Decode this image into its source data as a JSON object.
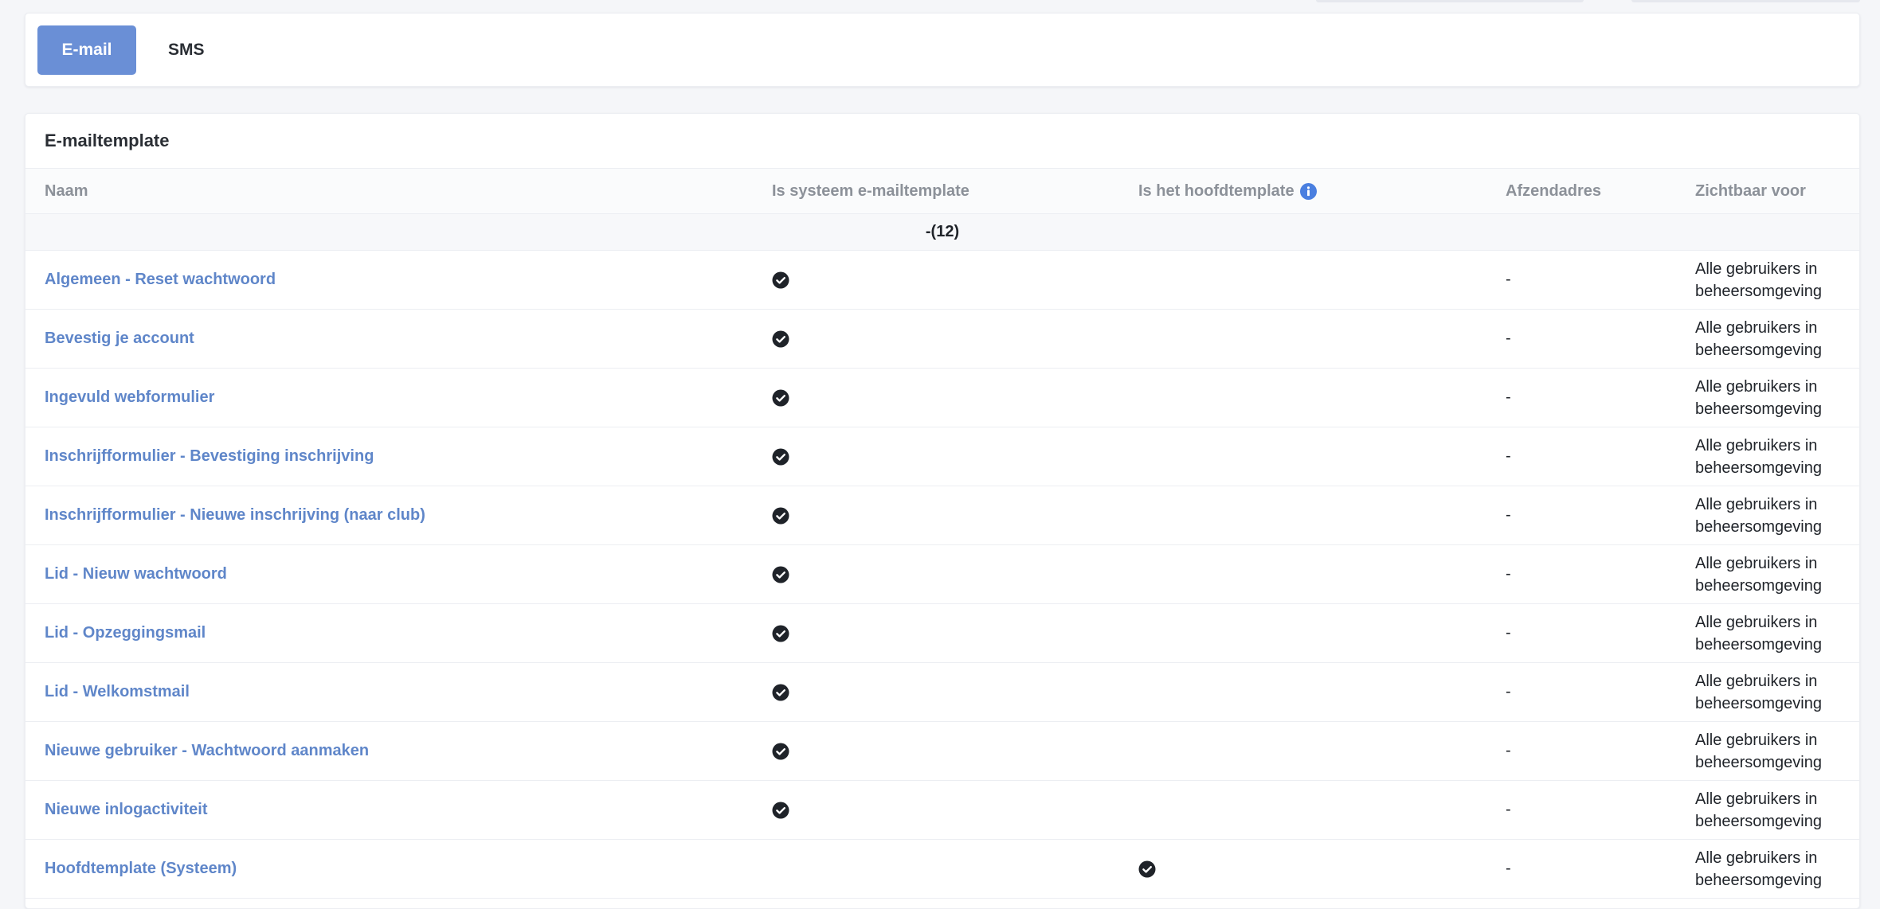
{
  "tabs": [
    {
      "label": "E-mail",
      "active": true
    },
    {
      "label": "SMS",
      "active": false
    }
  ],
  "card": {
    "title": "E-mailtemplate"
  },
  "columns": {
    "name": "Naam",
    "is_system": "Is systeem e-mailtemplate",
    "is_main": "Is het hoofdtemplate",
    "sender": "Afzendadres",
    "visible_for": "Zichtbaar voor"
  },
  "group": {
    "label": "-(12)"
  },
  "rows": [
    {
      "name": "Algemeen - Reset wachtwoord",
      "is_system": true,
      "is_main": false,
      "sender": "-",
      "visible_for": "Alle gebruikers in beheersomgeving"
    },
    {
      "name": "Bevestig je account",
      "is_system": true,
      "is_main": false,
      "sender": "-",
      "visible_for": "Alle gebruikers in beheersomgeving"
    },
    {
      "name": "Ingevuld webformulier",
      "is_system": true,
      "is_main": false,
      "sender": "-",
      "visible_for": "Alle gebruikers in beheersomgeving"
    },
    {
      "name": "Inschrijfformulier - Bevestiging inschrijving",
      "is_system": true,
      "is_main": false,
      "sender": "-",
      "visible_for": "Alle gebruikers in beheersomgeving"
    },
    {
      "name": "Inschrijfformulier - Nieuwe inschrijving (naar club)",
      "is_system": true,
      "is_main": false,
      "sender": "-",
      "visible_for": "Alle gebruikers in beheersomgeving"
    },
    {
      "name": "Lid - Nieuw wachtwoord",
      "is_system": true,
      "is_main": false,
      "sender": "-",
      "visible_for": "Alle gebruikers in beheersomgeving"
    },
    {
      "name": "Lid - Opzeggingsmail",
      "is_system": true,
      "is_main": false,
      "sender": "-",
      "visible_for": "Alle gebruikers in beheersomgeving"
    },
    {
      "name": "Lid - Welkomstmail",
      "is_system": true,
      "is_main": false,
      "sender": "-",
      "visible_for": "Alle gebruikers in beheersomgeving"
    },
    {
      "name": "Nieuwe gebruiker - Wachtwoord aanmaken",
      "is_system": true,
      "is_main": false,
      "sender": "-",
      "visible_for": "Alle gebruikers in beheersomgeving"
    },
    {
      "name": "Nieuwe inlogactiviteit",
      "is_system": true,
      "is_main": false,
      "sender": "-",
      "visible_for": "Alle gebruikers in beheersomgeving"
    },
    {
      "name": "Hoofdtemplate (Systeem)",
      "is_system": false,
      "is_main": true,
      "sender": "-",
      "visible_for": "Alle gebruikers in beheersomgeving"
    }
  ],
  "icons": {
    "check": "check-circle-icon",
    "info": "info-circle-icon"
  },
  "colors": {
    "accent": "#6a8fd6",
    "link": "#5f86c9",
    "info": "#4a7fe0",
    "check": "#1f2329"
  }
}
